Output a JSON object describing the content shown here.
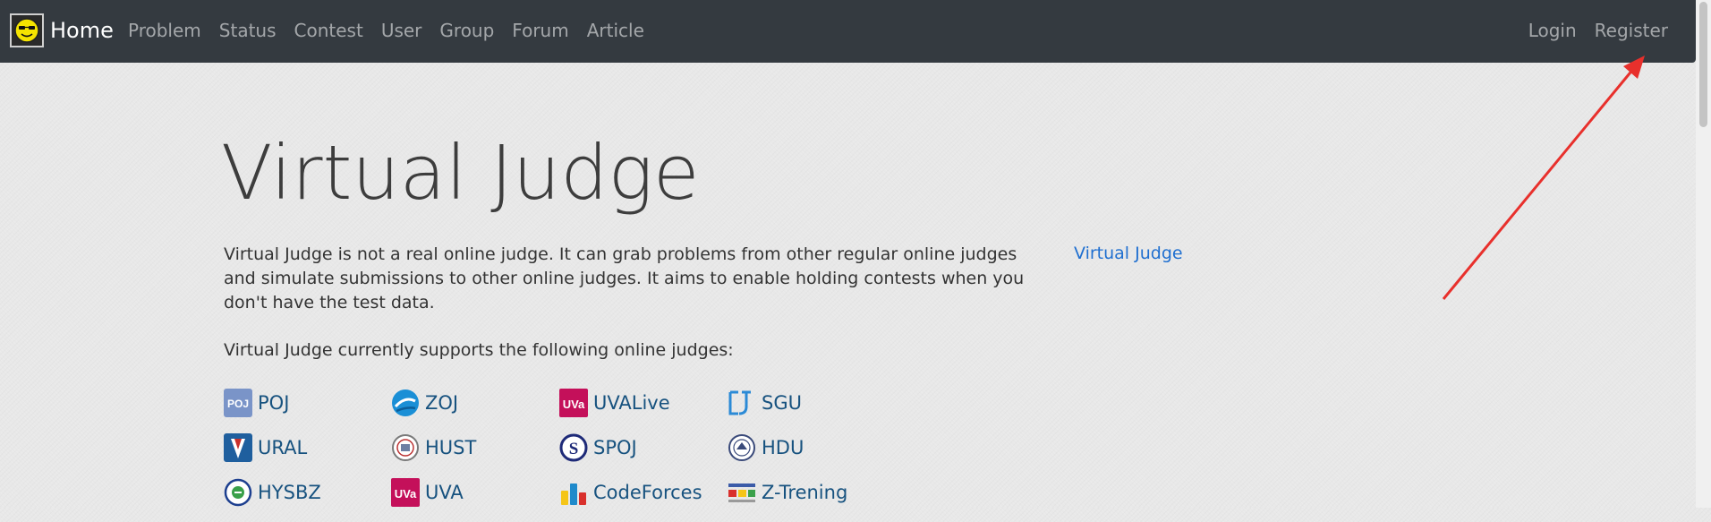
{
  "navbar": {
    "brand": "Home",
    "links": [
      "Problem",
      "Status",
      "Contest",
      "User",
      "Group",
      "Forum",
      "Article"
    ],
    "login": "Login",
    "register": "Register"
  },
  "main": {
    "title": "Virtual Judge",
    "intro": "Virtual Judge is not a real online judge. It can grab problems from other regular online judges and simulate submissions to other online judges. It aims to enable holding contests when you don't have the test data.",
    "supports_text": "Virtual Judge currently supports the following online judges:",
    "side_link": "Virtual Judge",
    "judges": [
      {
        "name": "POJ",
        "icon": "poj-icon",
        "icon_text": "POJ"
      },
      {
        "name": "ZOJ",
        "icon": "zoj-icon"
      },
      {
        "name": "UVALive",
        "icon": "uvalive-icon",
        "icon_text": "UVa"
      },
      {
        "name": "SGU",
        "icon": "sgu-icon"
      },
      {
        "name": "URAL",
        "icon": "ural-icon"
      },
      {
        "name": "HUST",
        "icon": "hust-icon"
      },
      {
        "name": "SPOJ",
        "icon": "spoj-icon",
        "icon_text": "S"
      },
      {
        "name": "HDU",
        "icon": "hdu-icon"
      },
      {
        "name": "HYSBZ",
        "icon": "hysbz-icon"
      },
      {
        "name": "UVA",
        "icon": "uva-icon",
        "icon_text": "UVa"
      },
      {
        "name": "CodeForces",
        "icon": "codeforces-icon"
      },
      {
        "name": "Z-Trening",
        "icon": "z-trening-icon"
      }
    ]
  },
  "colors": {
    "navbar_bg": "#343a40",
    "link_blue": "#1f6fd0",
    "judge_name": "#17527f",
    "arrow_red": "#e8302c"
  }
}
